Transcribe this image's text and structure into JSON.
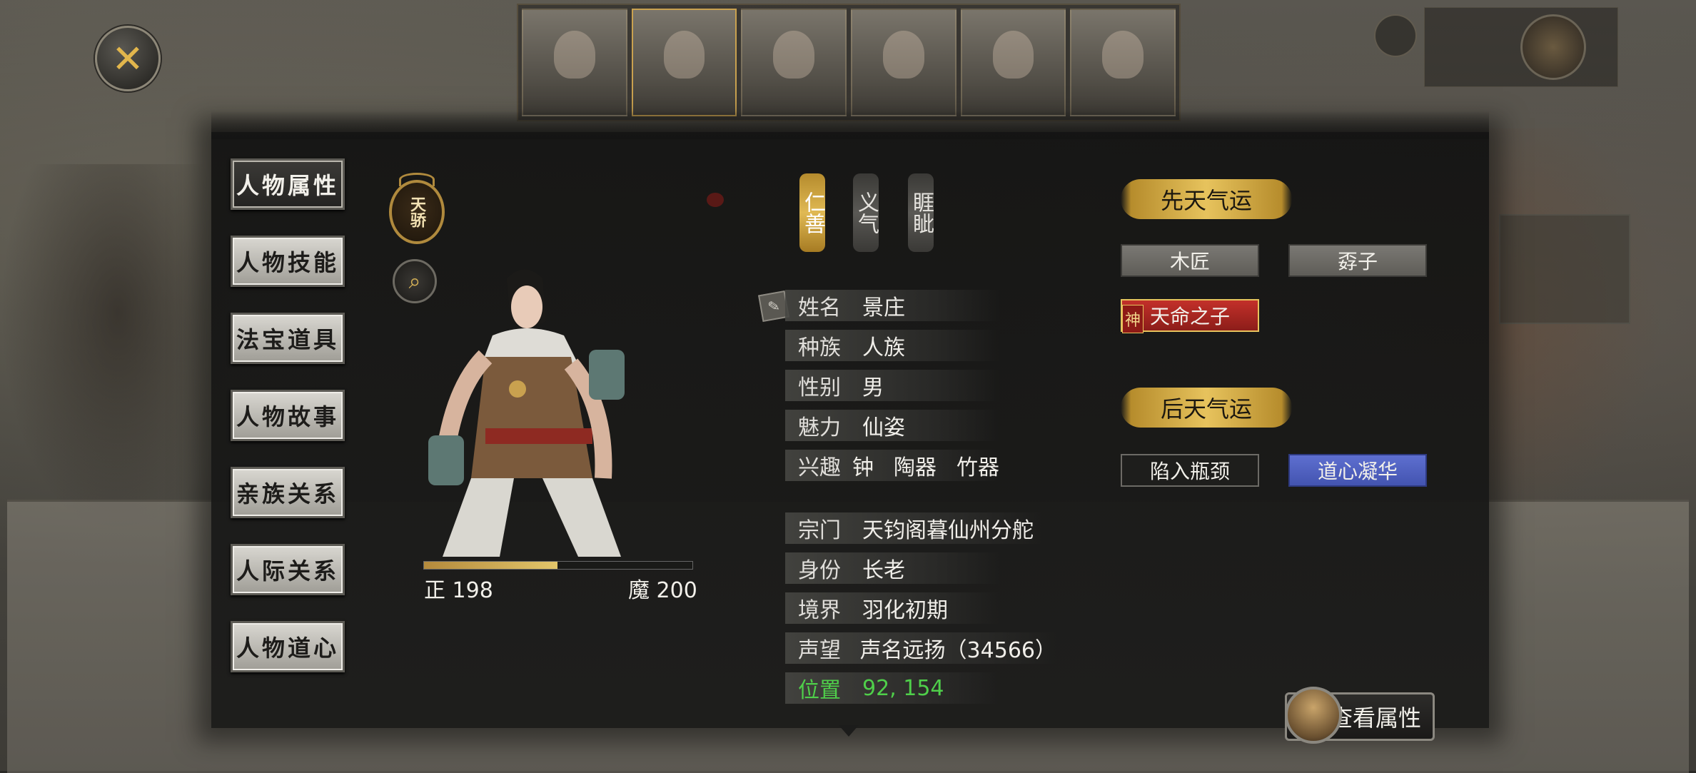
{
  "close": {
    "label": "✕"
  },
  "tabs": [
    {
      "label": "人物属性",
      "active": true
    },
    {
      "label": "人物技能",
      "active": false
    },
    {
      "label": "法宝道具",
      "active": false
    },
    {
      "label": "人物故事",
      "active": false
    },
    {
      "label": "亲族关系",
      "active": false
    },
    {
      "label": "人际关系",
      "active": false
    },
    {
      "label": "人物道心",
      "active": false
    }
  ],
  "badge": {
    "label": "天骄"
  },
  "morality": {
    "left": "正 198",
    "right": "魔 200",
    "good": 198,
    "evil": 200
  },
  "traits": [
    {
      "label": "仁善",
      "style": "gold"
    },
    {
      "label": "义气",
      "style": "grey"
    },
    {
      "label": "睚眦",
      "style": "grey"
    }
  ],
  "info": {
    "name": {
      "label": "姓名",
      "value": "景庄"
    },
    "race": {
      "label": "种族",
      "value": "人族"
    },
    "gender": {
      "label": "性别",
      "value": "男"
    },
    "charm": {
      "label": "魅力",
      "value": "仙姿"
    },
    "hobby": {
      "label": "兴趣",
      "items": [
        "钟",
        "陶器",
        "竹器"
      ]
    },
    "sect": {
      "label": "宗门",
      "value": "天钧阁暮仙州分舵"
    },
    "identity": {
      "label": "身份",
      "value": "长老"
    },
    "realm": {
      "label": "境界",
      "value": "羽化初期"
    },
    "fame": {
      "label": "声望",
      "value": "声名远扬（34566）"
    },
    "position": {
      "label": "位置",
      "value": "92, 154"
    }
  },
  "innate_fortune": {
    "title": "先天气运",
    "tags": [
      "木匠",
      "孬子",
      "天命之子"
    ],
    "divine_mark": "神"
  },
  "acquired_fortune": {
    "title": "后天气运",
    "tags": [
      "陷入瓶颈",
      "道心凝华"
    ]
  },
  "view_attributes": {
    "label": "查看属性"
  },
  "colors": {
    "gold": "#e7c35d",
    "green": "#4fcf4a",
    "red": "#c3302a",
    "blue": "#5e6fd0"
  }
}
